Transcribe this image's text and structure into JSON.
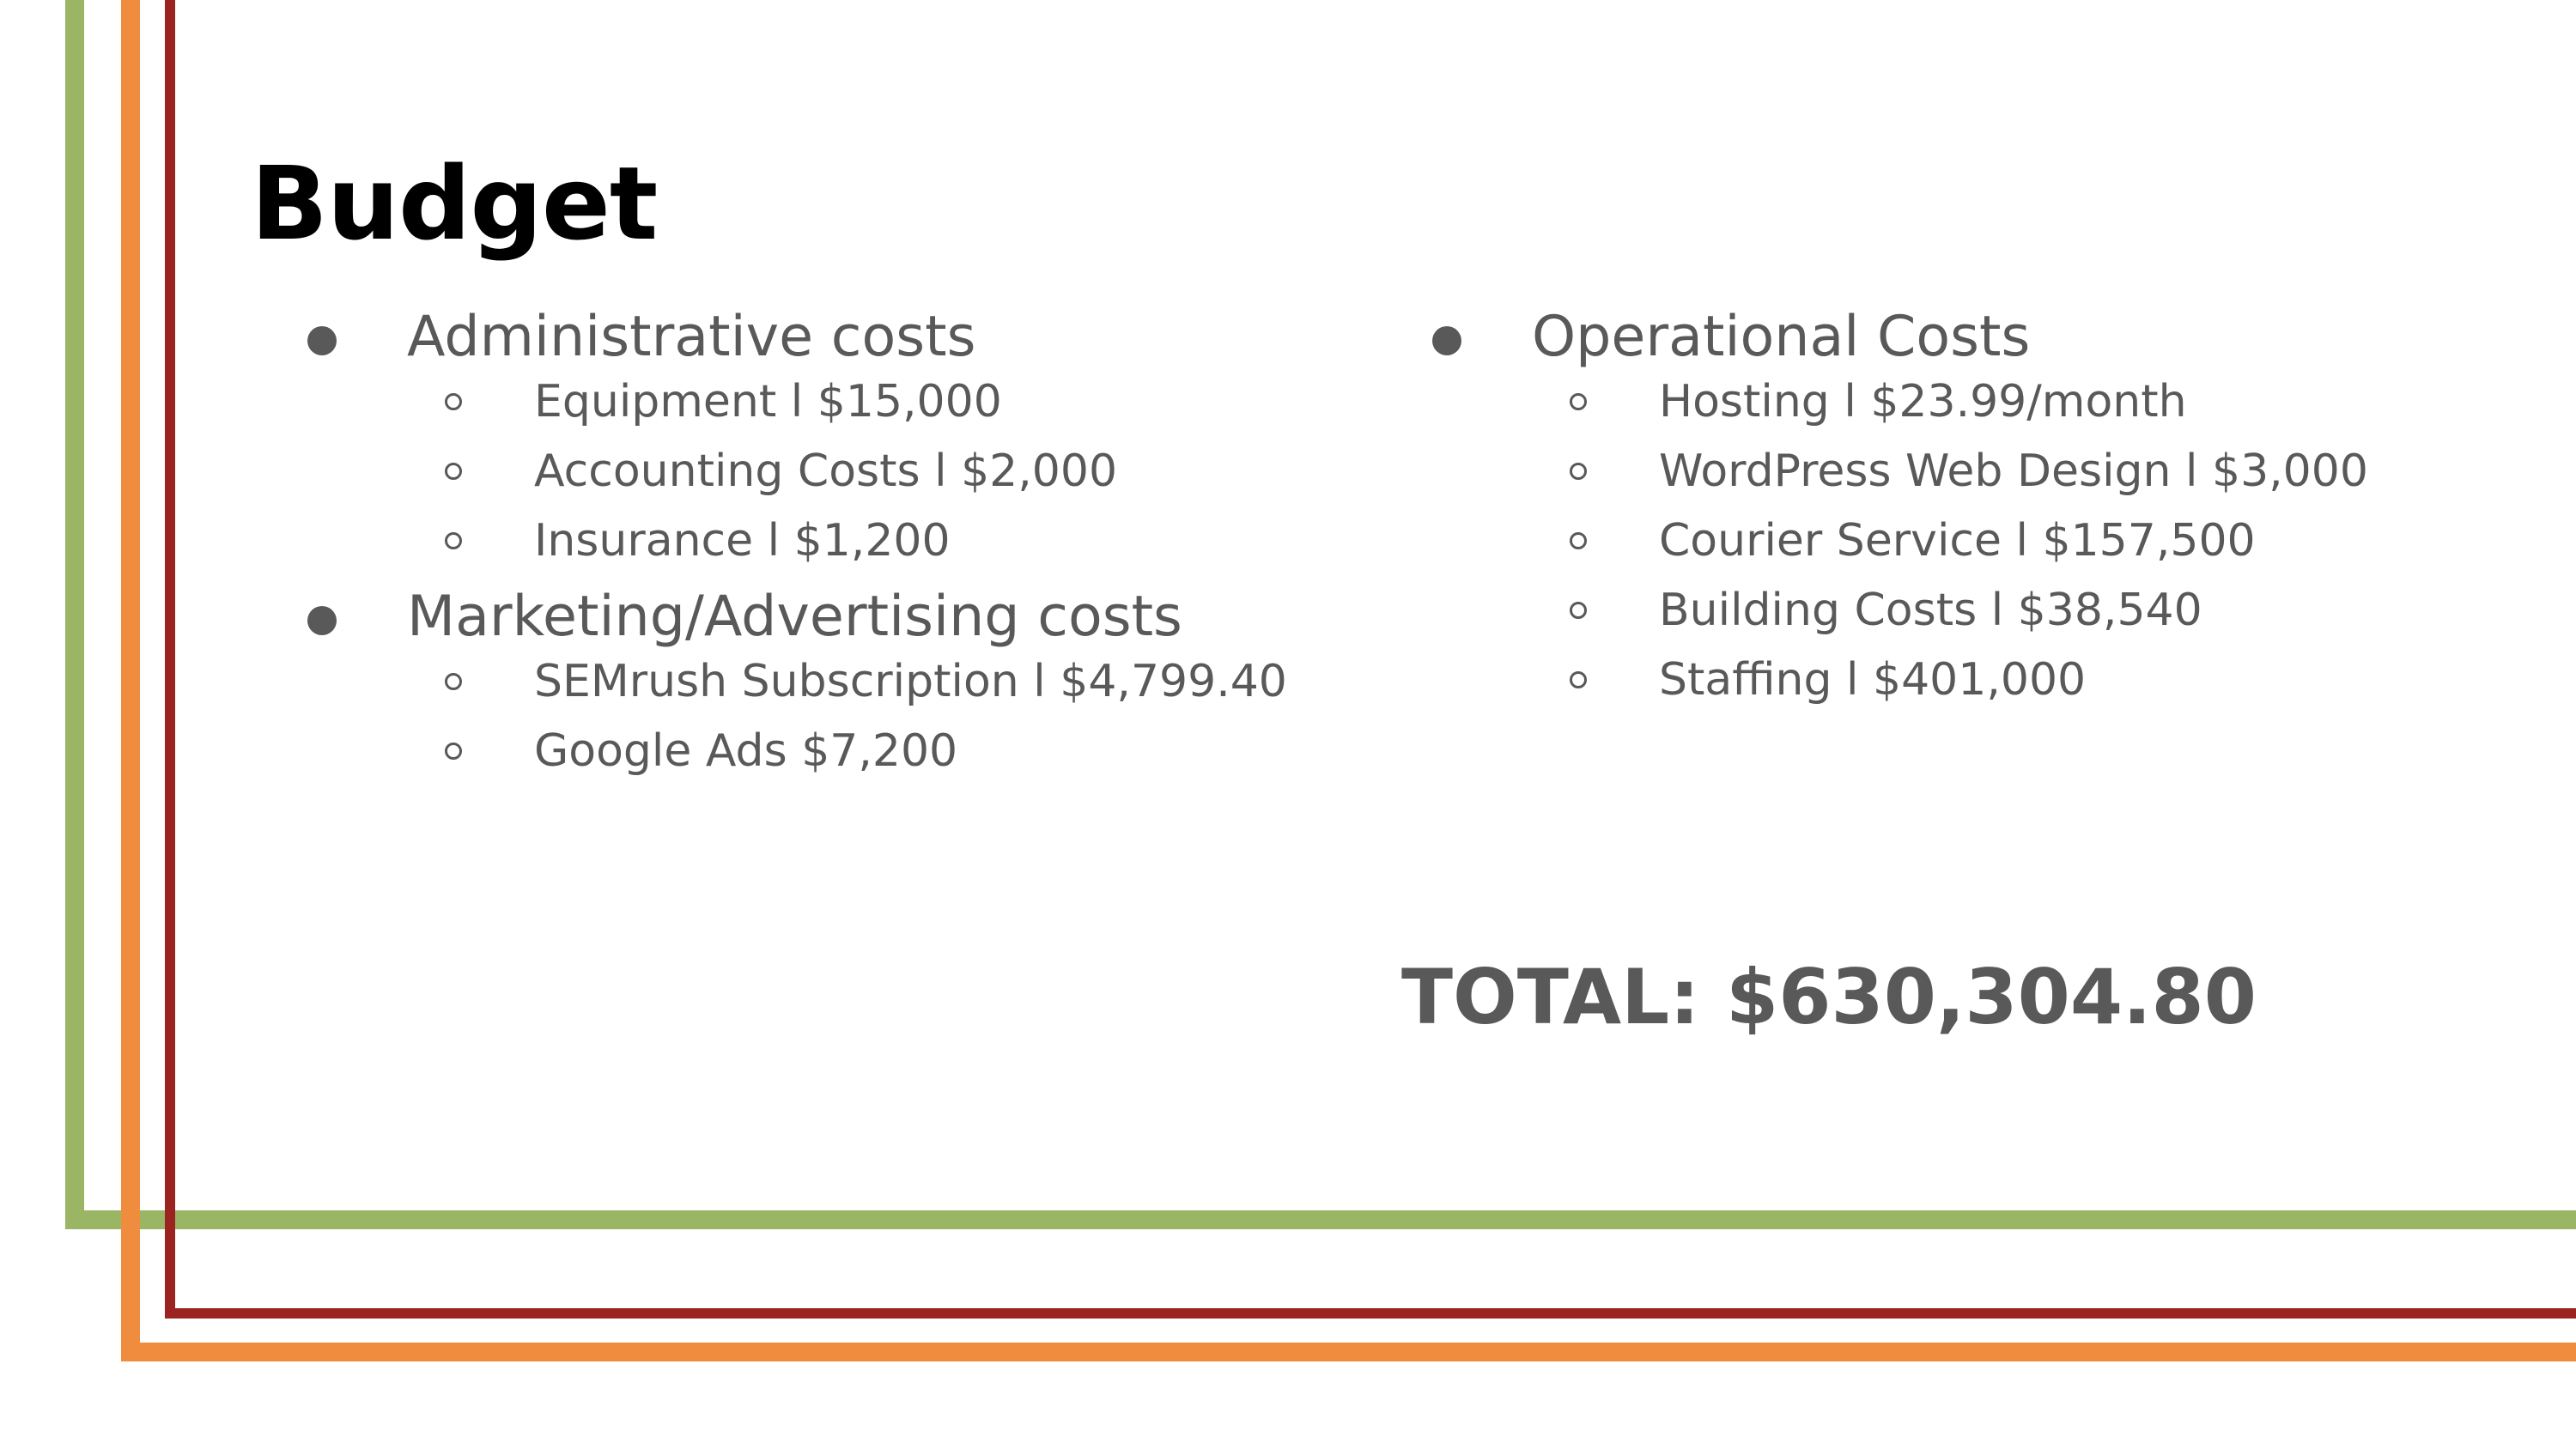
{
  "slide": {
    "title": "Budget",
    "total": "TOTAL: $630,304.80"
  },
  "colors": {
    "green": "#9ab563",
    "orange": "#f08c3e",
    "dark_red": "#9c2420",
    "text": "#595959",
    "title": "#000000"
  },
  "left_column": [
    {
      "label": "Administrative costs",
      "items": [
        "Equipment l $15,000",
        "Accounting Costs l $2,000",
        "Insurance l $1,200"
      ]
    },
    {
      "label": "Marketing/Advertising costs",
      "items": [
        "SEMrush Subscription l $4,799.40",
        "Google Ads $7,200"
      ]
    }
  ],
  "right_column": [
    {
      "label": "Operational Costs",
      "items": [
        "Hosting l $23.99/month",
        "WordPress Web Design l $3,000",
        "Courier Service l $157,500",
        "Building Costs l $38,540",
        "Staffing l $401,000"
      ]
    }
  ]
}
